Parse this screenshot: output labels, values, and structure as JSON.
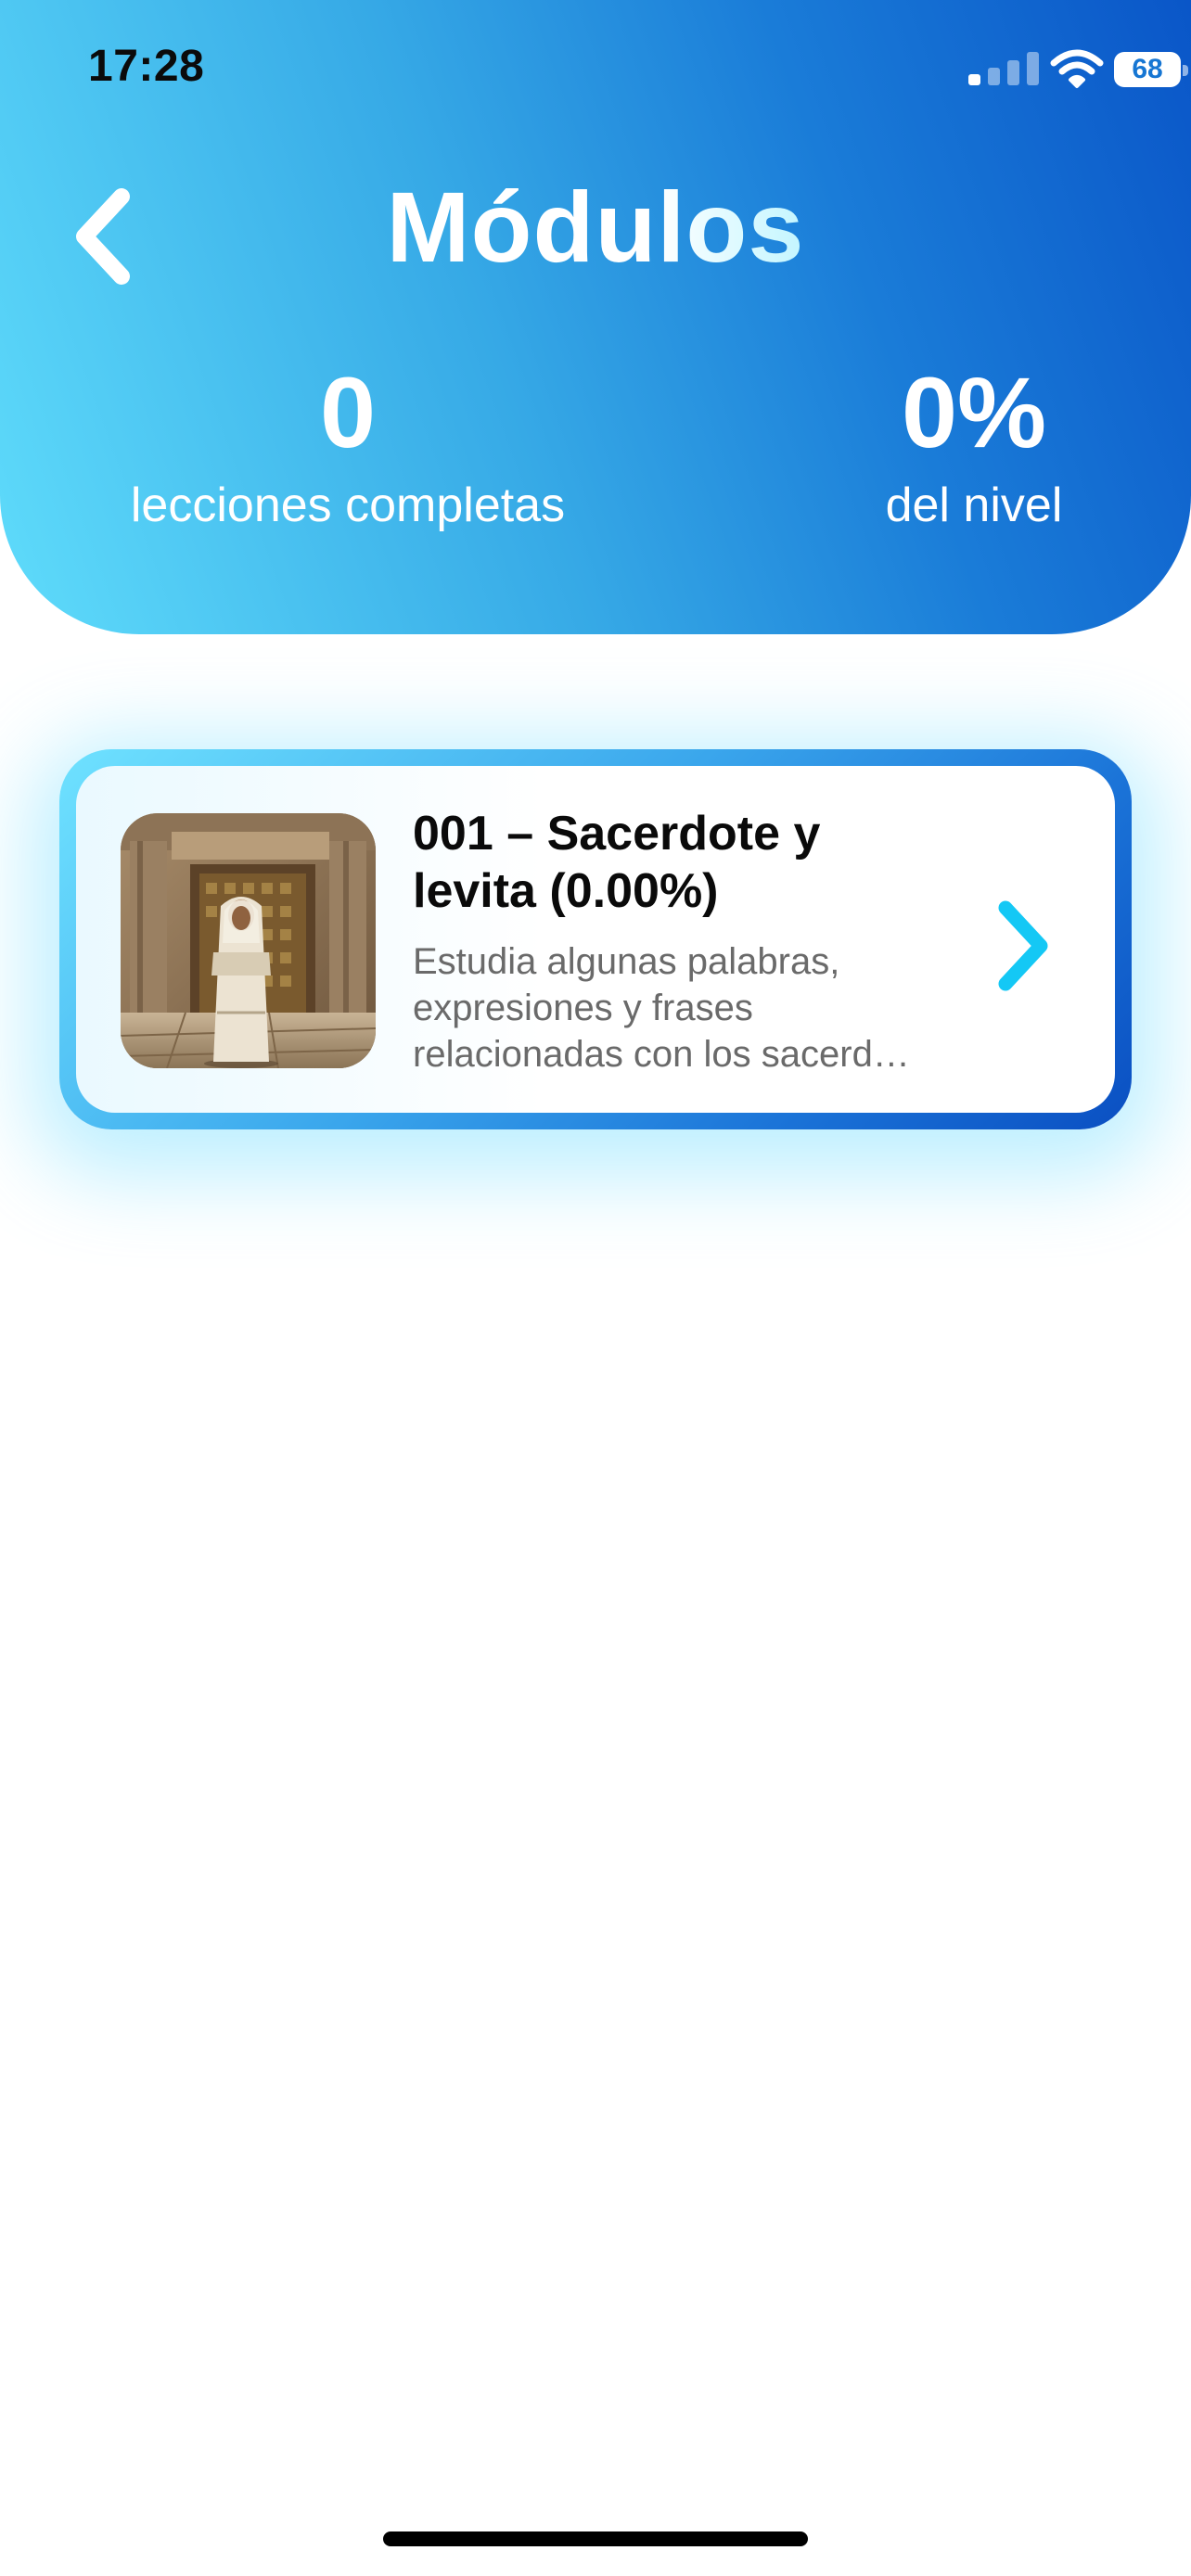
{
  "status_bar": {
    "time": "17:28",
    "battery": "68"
  },
  "header": {
    "title": "Módulos",
    "stats": {
      "lessons_value": "0",
      "lessons_label": "lecciones completas",
      "level_value": "0%",
      "level_label": "del nivel"
    }
  },
  "modules": [
    {
      "title": "001 – Sacerdote y levita (0.00%)",
      "description": "Estudia algunas palabras, expresiones y frases relacionadas con los sacerd…",
      "progress_percent": 0,
      "image_icon": "priest-temple-image"
    }
  ],
  "colors": {
    "header_gradient_start": "#5fdcfb",
    "header_gradient_end": "#0a56c8",
    "accent_chevron": "#14c8f5",
    "title_text": "#0a0a0a",
    "description_text": "#6a6a6a"
  }
}
